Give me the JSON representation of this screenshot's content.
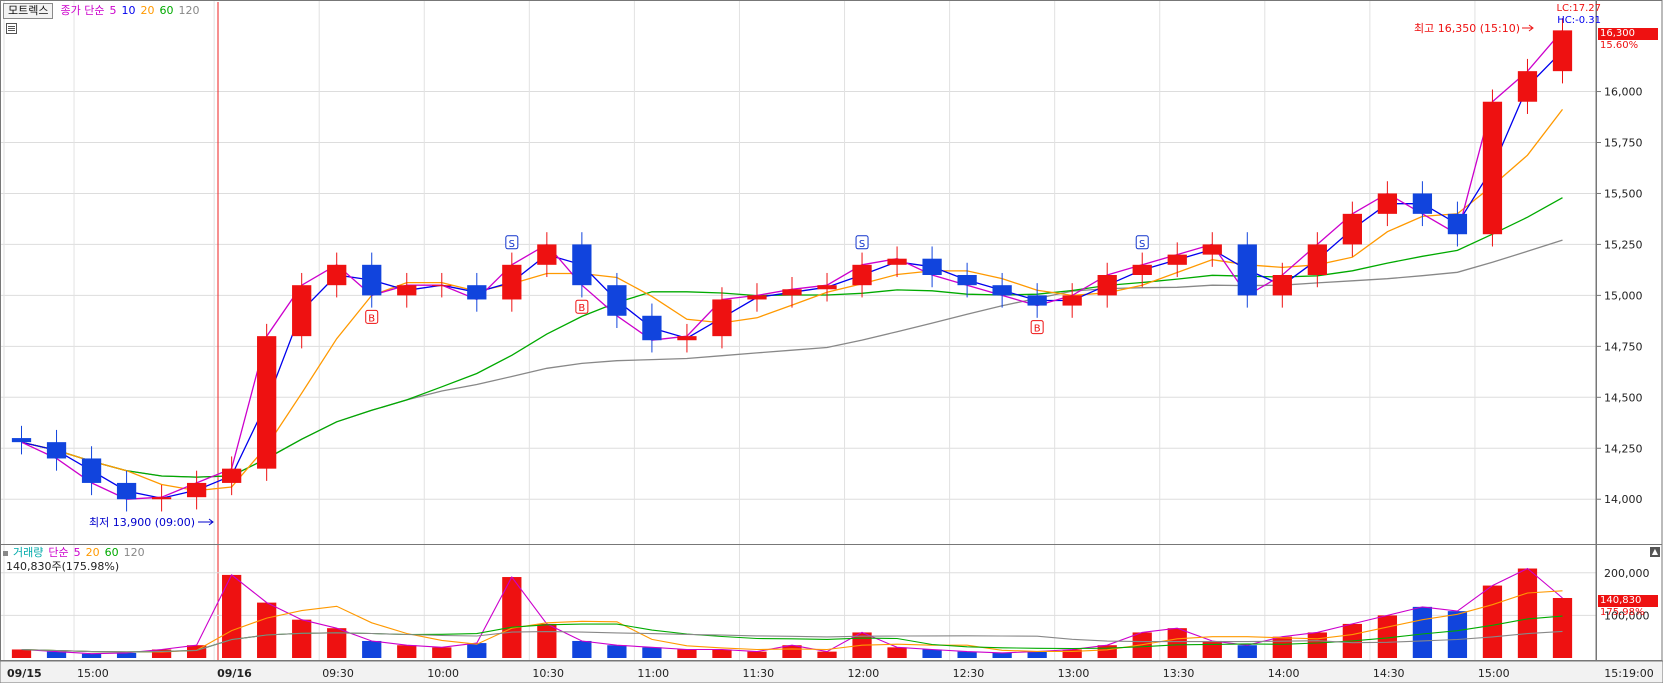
{
  "price_panel": {
    "symbol": "모트렉스",
    "legend_title": "종가 단순",
    "periods": [
      "5",
      "10",
      "20",
      "60",
      "120"
    ],
    "ma_colors": [
      "#cc00cc",
      "#0000ee",
      "#ff9900",
      "#00aa00",
      "#888888"
    ],
    "lc": "LC:17.27",
    "hc": "HC:-0.31",
    "current_price": "16,300",
    "current_pct": "15.60%",
    "high_label": "최고 16,350 (15:10)",
    "low_label": "최저 13,900 (09:00)",
    "y_ticks": [
      "16,000",
      "15,750",
      "15,500",
      "15,250",
      "15,000",
      "14,750",
      "14,500",
      "14,250",
      "14,000"
    ]
  },
  "volume_panel": {
    "legend_title": "거래량",
    "legend_ma": "단순",
    "periods": [
      "5",
      "20",
      "60",
      "120"
    ],
    "ma_colors": [
      "#cc00cc",
      "#ff9900",
      "#00aa00",
      "#888888"
    ],
    "current_volume": "140,830주(175.98%)",
    "current_volume_chip": "140,830",
    "current_pct_chip": "175.98%",
    "y_ticks": [
      "200,000",
      "100,000"
    ]
  },
  "time_axis": {
    "labels": [
      "09/15",
      "15:00",
      "09/16",
      "09:30",
      "10:00",
      "10:30",
      "11:00",
      "11:30",
      "12:00",
      "12:30",
      "13:00",
      "13:30",
      "14:00",
      "14:30",
      "15:00"
    ],
    "current_time": "15:19:00"
  },
  "chart_data": {
    "type": "candlestick",
    "title": "모트렉스",
    "x": [
      "09/15 14:35",
      "09/15 14:45",
      "09/15 14:55",
      "09/15 15:05",
      "09/15 15:15",
      "09/15 15:25",
      "09/16 09:00",
      "09/16 09:10",
      "09/16 09:20",
      "09/16 09:30",
      "09/16 09:40",
      "09/16 09:50",
      "09/16 10:00",
      "09/16 10:10",
      "09/16 10:20",
      "09/16 10:30",
      "09/16 10:40",
      "09/16 10:50",
      "09/16 11:00",
      "09/16 11:10",
      "09/16 11:20",
      "09/16 11:30",
      "09/16 11:40",
      "09/16 11:50",
      "09/16 12:00",
      "09/16 12:10",
      "09/16 12:20",
      "09/16 12:30",
      "09/16 12:40",
      "09/16 12:50",
      "09/16 13:00",
      "09/16 13:10",
      "09/16 13:20",
      "09/16 13:30",
      "09/16 13:40",
      "09/16 13:50",
      "09/16 14:00",
      "09/16 14:10",
      "09/16 14:20",
      "09/16 14:30",
      "09/16 14:40",
      "09/16 14:50",
      "09/16 15:00",
      "09/16 15:10",
      "09/16 15:19"
    ],
    "series": [
      {
        "name": "종가",
        "values": [
          14280,
          14200,
          14080,
          14000,
          14010,
          14080,
          14150,
          14800,
          15050,
          15150,
          15000,
          15050,
          15050,
          14980,
          15150,
          15250,
          15050,
          14900,
          14780,
          14800,
          14980,
          15000,
          15030,
          15050,
          15150,
          15180,
          15100,
          15050,
          15000,
          14950,
          15000,
          15100,
          15150,
          15200,
          15250,
          15000,
          15100,
          15250,
          15400,
          15500,
          15400,
          15300,
          15950,
          16100,
          16300
        ]
      },
      {
        "name": "거래량",
        "values": [
          20000,
          15000,
          10000,
          12000,
          20000,
          30000,
          195000,
          130000,
          90000,
          70000,
          40000,
          30000,
          25000,
          35000,
          190000,
          80000,
          40000,
          30000,
          25000,
          20000,
          20000,
          15000,
          30000,
          15000,
          60000,
          25000,
          20000,
          15000,
          12000,
          15000,
          20000,
          30000,
          60000,
          70000,
          40000,
          30000,
          50000,
          60000,
          80000,
          100000,
          120000,
          110000,
          170000,
          210000,
          140830
        ]
      }
    ],
    "ylim": [
      13800,
      16400
    ],
    "y_ticks": [
      14000,
      14250,
      14500,
      14750,
      15000,
      15250,
      15500,
      15750,
      16000
    ],
    "volume_ylim": [
      0,
      230000
    ],
    "volume_ticks": [
      100000,
      200000
    ],
    "high": 16350,
    "low": 13900,
    "current": 16300,
    "grid": true,
    "legend": "top-left"
  }
}
